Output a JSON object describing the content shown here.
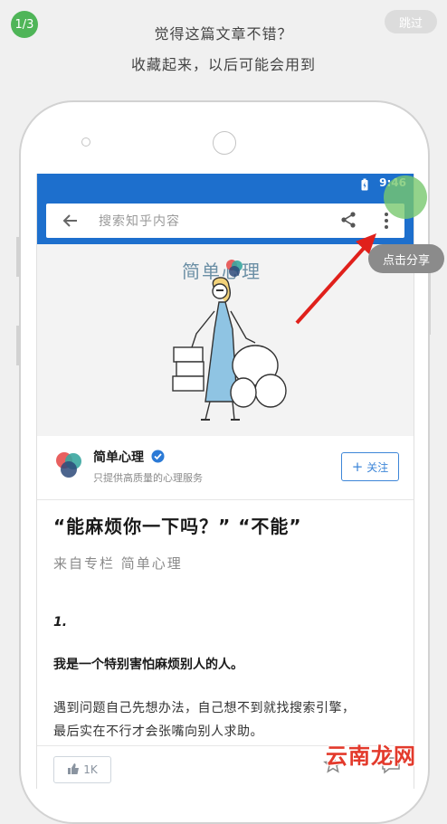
{
  "tutorial": {
    "step": "1/3",
    "skip_label": "跳过",
    "line1": "觉得这篇文章不错？",
    "line2": "收藏起来，以后可能会用到"
  },
  "phone": {
    "status_time": "9:46",
    "search_placeholder": "搜索知乎内容",
    "brand_name": "简单心理",
    "author_name": "简单心理",
    "author_bio": "只提供高质量的心理服务",
    "follow_label": "关注",
    "article_title": "“能麻烦你一下吗？” “不能”",
    "source": "来自专栏 简单心理",
    "section_number": "1.",
    "bold_line": "我是一个特别害怕麻烦别人的人。",
    "para_line1": "遇到问题自己先想办法，自己想不到就找搜索引擎，",
    "para_line2": "最后实在不行才会张嘴向别人求助。",
    "like_count": "1K"
  },
  "hint": {
    "tooltip": "点击分享"
  },
  "watermark": "云南龙网",
  "colors": {
    "accent_blue": "#1d6fcd",
    "step_green": "#4fb558",
    "arrow_red": "#e0201b",
    "verified_blue": "#2b7ad6"
  }
}
